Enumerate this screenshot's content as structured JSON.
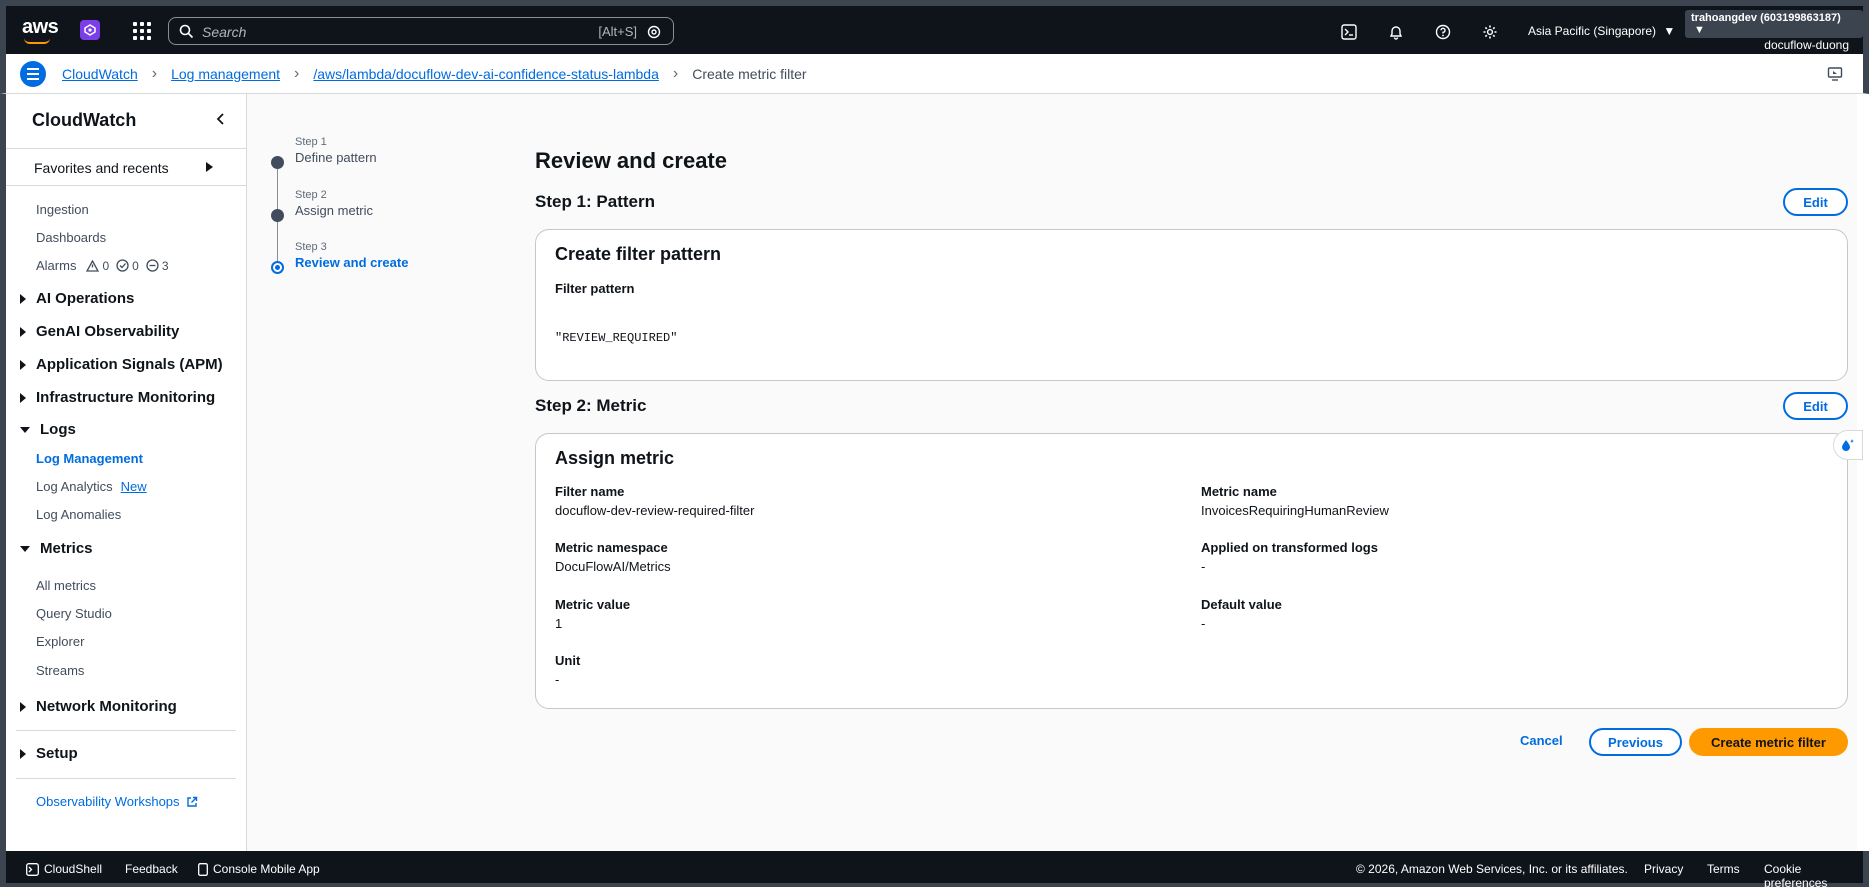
{
  "topnav": {
    "logo": "aws",
    "search_placeholder": "Search",
    "search_shortcut": "[Alt+S]",
    "region": "Asia Pacific (Singapore)",
    "account": "trahoangdev (603199863187)",
    "username": "docuflow-duong"
  },
  "breadcrumb": {
    "items": [
      "CloudWatch",
      "Log management",
      "/aws/lambda/docuflow-dev-ai-confidence-status-lambda"
    ],
    "current": "Create metric filter"
  },
  "sidebar": {
    "title": "CloudWatch",
    "favorites": "Favorites and recents",
    "top_links": [
      "Ingestion",
      "Dashboards",
      "Alarms"
    ],
    "alarm_counts": [
      "0",
      "0",
      "3"
    ],
    "sections": {
      "ai_operations": "AI Operations",
      "genai": "GenAI Observability",
      "app_signals": "Application Signals (APM)",
      "infra": "Infrastructure Monitoring",
      "logs": "Logs",
      "metrics": "Metrics",
      "network": "Network Monitoring",
      "setup": "Setup"
    },
    "logs_items": {
      "log_management": "Log Management",
      "log_analytics": "Log Analytics",
      "new_badge": "New",
      "log_anomalies": "Log Anomalies"
    },
    "metrics_items": [
      "All metrics",
      "Query Studio",
      "Explorer",
      "Streams"
    ],
    "workshops": "Observability Workshops"
  },
  "wizard": {
    "steps": [
      {
        "num": "Step 1",
        "label": "Define pattern"
      },
      {
        "num": "Step 2",
        "label": "Assign metric"
      },
      {
        "num": "Step 3",
        "label": "Review and create"
      }
    ]
  },
  "main": {
    "title": "Review and create",
    "edit_label": "Edit",
    "step1": {
      "heading": "Step 1: Pattern",
      "card_title": "Create filter pattern",
      "filter_pattern_label": "Filter pattern",
      "filter_pattern_value": "\"REVIEW_REQUIRED\""
    },
    "step2": {
      "heading": "Step 2: Metric",
      "card_title": "Assign metric",
      "filter_name_label": "Filter name",
      "filter_name_value": "docuflow-dev-review-required-filter",
      "metric_name_label": "Metric name",
      "metric_name_value": "InvoicesRequiringHumanReview",
      "namespace_label": "Metric namespace",
      "namespace_value": "DocuFlowAI/Metrics",
      "transformed_label": "Applied on transformed logs",
      "transformed_value": "-",
      "metric_value_label": "Metric value",
      "metric_value_value": "1",
      "default_value_label": "Default value",
      "default_value_value": "-",
      "unit_label": "Unit",
      "unit_value": "-"
    },
    "actions": {
      "cancel": "Cancel",
      "previous": "Previous",
      "create": "Create metric filter"
    }
  },
  "footer": {
    "cloudshell": "CloudShell",
    "feedback": "Feedback",
    "mobile": "Console Mobile App",
    "copyright": "© 2026, Amazon Web Services, Inc. or its affiliates.",
    "privacy": "Privacy",
    "terms": "Terms",
    "cookies": "Cookie preferences"
  },
  "colors": {
    "link": "#006ce0",
    "primary_button": "#ff9900",
    "nav_bg": "#0f141a"
  }
}
